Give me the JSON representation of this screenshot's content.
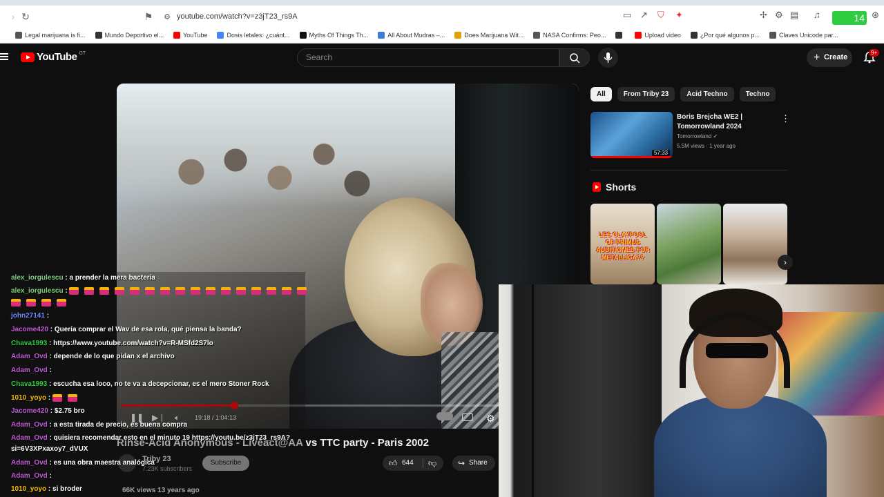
{
  "browser": {
    "url": "youtube.com/watch?v=z3jT23_rs9A",
    "bookmarks": [
      {
        "label": "Legal marijuana is fi...",
        "color": "#555555"
      },
      {
        "label": "Mundo Deportivo el...",
        "color": "#333333"
      },
      {
        "label": "YouTube",
        "color": "#ff0000"
      },
      {
        "label": "Dosis letales: ¿cuánt...",
        "color": "#4285f4"
      },
      {
        "label": "Myths Of Things Th...",
        "color": "#111111"
      },
      {
        "label": "All About Mudras –...",
        "color": "#3b7bd6"
      },
      {
        "label": "Does Marijuana Wit...",
        "color": "#e0a000"
      },
      {
        "label": "NASA Confirms: Peo...",
        "color": "#555555"
      },
      {
        "label": "",
        "color": "#333333"
      },
      {
        "label": "Upload video",
        "color": "#ff0000"
      },
      {
        "label": "¿Por qué algunos p...",
        "color": "#333333"
      },
      {
        "label": "Claves Unicode par...",
        "color": "#555555"
      }
    ]
  },
  "header": {
    "logo_text": "YouTube",
    "country_code": "GT",
    "search_placeholder": "Search",
    "create_label": "Create",
    "notifications_badge": "9+"
  },
  "video": {
    "title": "Rinse-Acid Anonymous - Liveact@AA vs TTC party - Paris 2002",
    "time_current": "19:18",
    "time_total": "1:04:13",
    "time_display": "19:18 / 1:04:13",
    "progress": 0.3,
    "channel": "Triby 23",
    "subscribers": "7.23K subscribers",
    "subscribe_label": "Subscribe",
    "likes": "644",
    "share_label": "Share",
    "views_line": "66K views  13 years ago"
  },
  "chips": [
    "All",
    "From Triby 23",
    "Acid Techno",
    "Techno"
  ],
  "recommended": {
    "title": "Boris Brejcha WE2 | Tomorrowland 2024",
    "channel": "Tomorrowland",
    "meta": "5.5M views · 1 year ago",
    "duration": "57:33"
  },
  "shorts": {
    "heading": "Shorts",
    "items": [
      {
        "caption": "LES CLAYPOOL OF PRIMUS AUDITIONED FOR METALLICA??"
      },
      {
        "caption": ""
      },
      {
        "caption": ""
      }
    ]
  },
  "chat": [
    {
      "user": "alex_iorgulescu",
      "color": "#7fd07f",
      "text": ": a prender la mera bacteria"
    },
    {
      "user": "alex_iorgulescu",
      "color": "#7fd07f",
      "text": ":"
    },
    {
      "user": "john27141",
      "color": "#6c8cff",
      "text": ":"
    },
    {
      "user": "Jacome420",
      "color": "#c25bd6",
      "text": ": Quería comprar el Wav de esa rola, qué piensa la banda?"
    },
    {
      "user": "Chava1993",
      "color": "#2ecc40",
      "text": ": https://www.youtube.com/watch?v=R-MSfd2S7lo"
    },
    {
      "user": "Adam_Ovd",
      "color": "#c25bd6",
      "text": ": depende de lo que pidan x el archivo"
    },
    {
      "user": "Adam_Ovd",
      "color": "#c25bd6",
      "text": ":"
    },
    {
      "user": "Chava1993",
      "color": "#2ecc40",
      "text": ": escucha esa loco, no te va a decepcionar, es el mero Stoner Rock"
    },
    {
      "user": "1010_yoyo",
      "color": "#f6c200",
      "text": ":"
    },
    {
      "user": "Jacome420",
      "color": "#c25bd6",
      "text": ": $2.75 bro"
    },
    {
      "user": "Adam_Ovd",
      "color": "#c25bd6",
      "text": ": a esta tirada de precio, es buena compra"
    },
    {
      "user": "Adam_Ovd",
      "color": "#c25bd6",
      "text": ": quisiera recomendar esto en el minuto 19 https://youtu.be/z3jT23_rs9A?"
    },
    {
      "user": "",
      "color": "#ffffff",
      "text": "si=6V3XPxaxoy7_dVUX"
    },
    {
      "user": "Adam_Ovd",
      "color": "#c25bd6",
      "text": ": es una obra maestra analógica"
    },
    {
      "user": "Adam_Ovd",
      "color": "#c25bd6",
      "text": ":"
    },
    {
      "user": "1010_yoyo",
      "color": "#f6c200",
      "text": ": si broder"
    }
  ]
}
